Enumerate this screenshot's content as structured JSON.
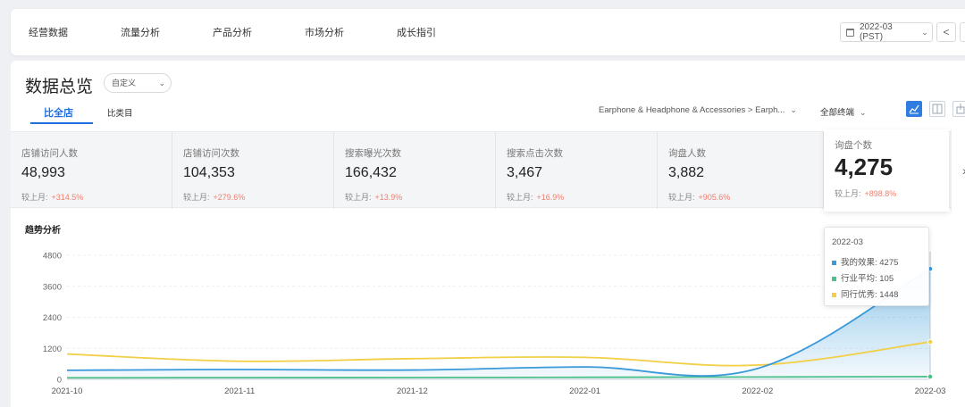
{
  "nav": {
    "tabs": [
      "经营数据",
      "流量分析",
      "产品分析",
      "市场分析",
      "成长指引"
    ],
    "date": "2022-03 (PST)",
    "prev": "<",
    "next": ">"
  },
  "header": {
    "title": "数据总览",
    "select_value": "自定义",
    "subtabs": [
      "比全店",
      "比类目"
    ],
    "category_path": "Earphone & Headphone & Accessories > Earph...",
    "filter": "全部终端"
  },
  "metrics": [
    {
      "label": "店铺访问人数",
      "value": "48,993",
      "comp_label": "较上月:",
      "comp_value": "+314.5%"
    },
    {
      "label": "店铺访问次数",
      "value": "104,353",
      "comp_label": "较上月:",
      "comp_value": "+279.6%"
    },
    {
      "label": "搜索曝光次数",
      "value": "166,432",
      "comp_label": "较上月:",
      "comp_value": "+13.9%"
    },
    {
      "label": "搜索点击次数",
      "value": "3,467",
      "comp_label": "较上月:",
      "comp_value": "+16.9%"
    },
    {
      "label": "询盘人数",
      "value": "3,882",
      "comp_label": "较上月:",
      "comp_value": "+905.6%"
    },
    {
      "label": "询盘个数",
      "value": "4,275",
      "comp_label": "较上月:",
      "comp_value": "+898.8%"
    }
  ],
  "section_title": "趋势分析",
  "colors": {
    "accent": "#1f6fe0",
    "mine": "#3a9ad9",
    "avg": "#4cc08b",
    "top": "#f2cf45",
    "up": "#f07f6f"
  },
  "chart_data": {
    "type": "line",
    "categories": [
      "2021-10",
      "2021-11",
      "2021-12",
      "2022-01",
      "2022-02",
      "2022-03"
    ],
    "yticks": [
      0,
      1200,
      2400,
      3600,
      4800
    ],
    "ylim": [
      0,
      4800
    ],
    "series": [
      {
        "name": "我的效果",
        "values": [
          350,
          380,
          360,
          480,
          420,
          4275
        ],
        "color": "#3a9ad9"
      },
      {
        "name": "行业平均",
        "values": [
          60,
          65,
          70,
          80,
          90,
          105
        ],
        "color": "#4cc08b"
      },
      {
        "name": "同行优秀",
        "values": [
          980,
          700,
          800,
          850,
          550,
          1448
        ],
        "color": "#f2cf45"
      }
    ],
    "grid": true,
    "tooltip": {
      "title": "2022-03",
      "rows": [
        {
          "label": "我的效果: 4275",
          "color": "#3a9ad9"
        },
        {
          "label": "行业平均: 105",
          "color": "#4cc08b"
        },
        {
          "label": "同行优秀: 1448",
          "color": "#f2cf45"
        }
      ]
    }
  }
}
